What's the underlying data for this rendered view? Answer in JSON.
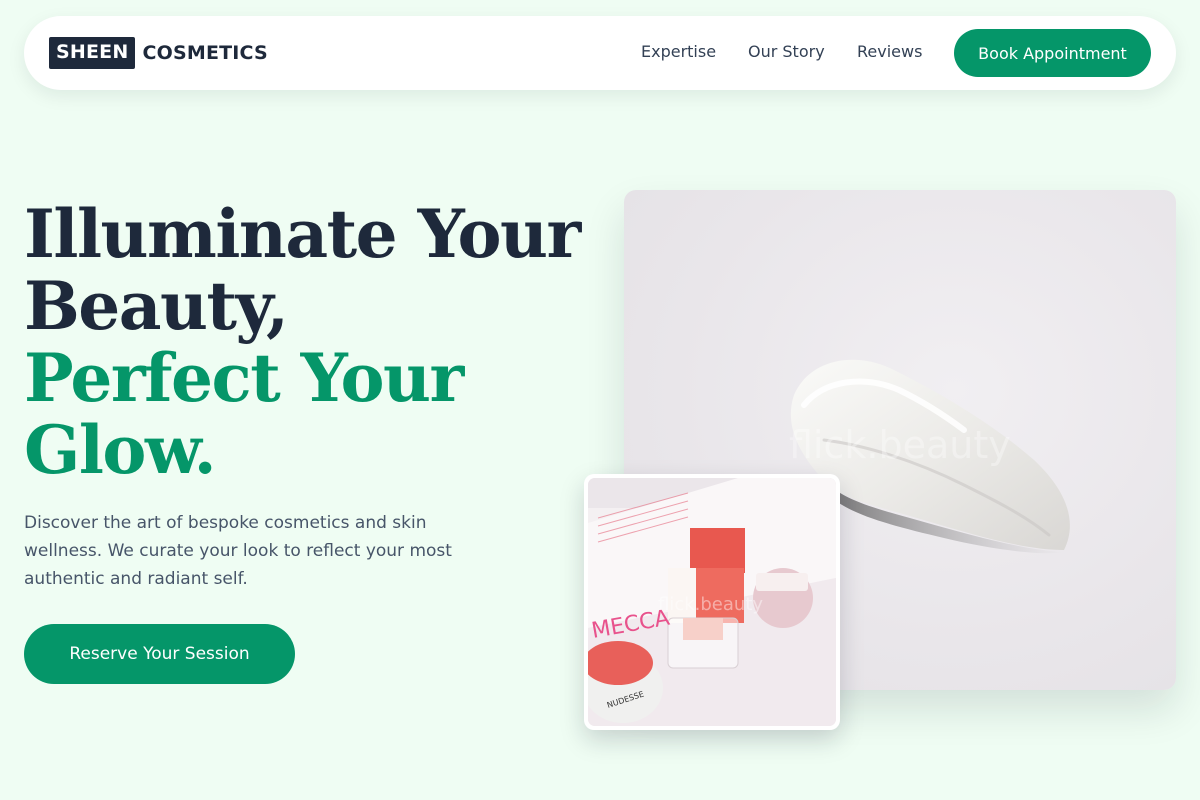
{
  "brand": {
    "logo_box": "SHEEN",
    "logo_text": "COSMETICS"
  },
  "nav": {
    "links": [
      "Expertise",
      "Our Story",
      "Reviews"
    ],
    "cta": "Book Appointment"
  },
  "hero": {
    "headline_dark": [
      "Illuminate Your",
      "Beauty,"
    ],
    "headline_green": [
      "Perfect Your",
      "Glow."
    ],
    "description": "Discover the art of bespoke cosmetics and skin wellness. We curate your look to reflect your most authentic and radiant self.",
    "cta": "Reserve Your Session"
  },
  "images": {
    "main_watermark": "flick.beauty",
    "thumb_watermark": "flick.beauty",
    "thumb_label_box": "MECCA",
    "thumb_label_jar": "NUDESSE"
  },
  "colors": {
    "background": "#effdf3",
    "accent": "#059669",
    "dark": "#1e293b"
  }
}
